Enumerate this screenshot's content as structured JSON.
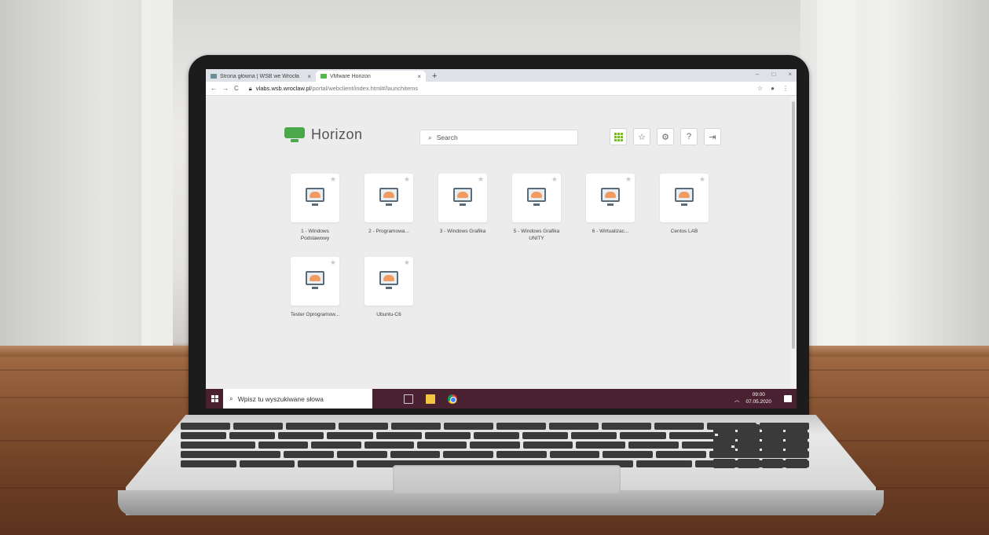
{
  "browser": {
    "tabs": [
      {
        "title": "Strona główna | WSB we Wrocła",
        "active": false
      },
      {
        "title": "VMware Horizon",
        "active": true
      }
    ],
    "new_tab": "+",
    "tab_close": "×",
    "url_host": "vlabs.wsb.wroclaw.pl",
    "url_path": "/portal/webclient/index.html#/launchitems",
    "nav": {
      "back": "←",
      "forward": "→",
      "reload": "C"
    },
    "window_controls": [
      "–",
      "□",
      "×"
    ]
  },
  "horizon": {
    "logo_text": "Horizon",
    "search_placeholder": "Search",
    "brand_color": "#4aa84a"
  },
  "apps": [
    {
      "label": "1 - Windows Podstawowy"
    },
    {
      "label": "2 - Programowa..."
    },
    {
      "label": "3 - Windows Grafika"
    },
    {
      "label": "5 - Windows Grafika UNITY"
    },
    {
      "label": "6 - Wirtualizac..."
    },
    {
      "label": "Centos LAB"
    },
    {
      "label": "Tester Oprogramow..."
    },
    {
      "label": "Ubuntu-C6"
    }
  ],
  "taskbar": {
    "search_placeholder": "Wpisz tu wyszukiwane słowa",
    "time": "09:00",
    "date": "07.05.2020",
    "color": "#4a2130"
  }
}
